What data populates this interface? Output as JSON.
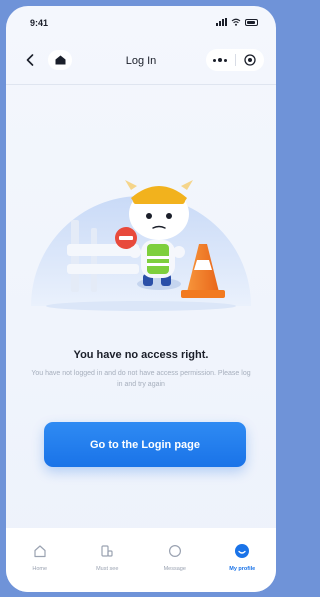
{
  "status_bar": {
    "time": "9:41"
  },
  "nav": {
    "title": "Log In"
  },
  "empty_state": {
    "title": "You have no access right.",
    "description": "You have not logged in and do not have access permission. Please log in and try again"
  },
  "login_button": {
    "label": "Go to the Login page"
  },
  "tab_bar": {
    "items": [
      {
        "label": "Home",
        "icon": "home-icon",
        "active": false
      },
      {
        "label": "Must see",
        "icon": "grid-icon",
        "active": false
      },
      {
        "label": "Message",
        "icon": "message-icon",
        "active": false
      },
      {
        "label": "My profile",
        "icon": "profile-icon",
        "active": true
      }
    ]
  },
  "colors": {
    "accent": "#1a73e8",
    "background": "#f4f7fd",
    "frame": "#6f93d8",
    "cone_orange": "#f27a1f",
    "mascot_yellow": "#f2b21d"
  }
}
